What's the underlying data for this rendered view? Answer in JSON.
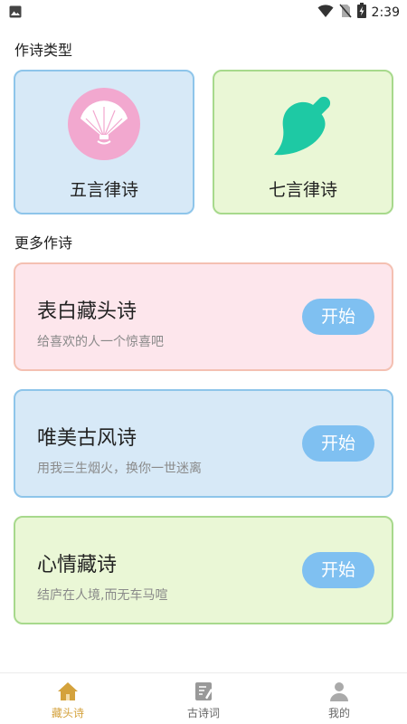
{
  "status_bar": {
    "time": "2:39",
    "icons": [
      "image-icon",
      "wifi-icon",
      "no-sim-icon",
      "battery-charging-icon"
    ]
  },
  "sections": {
    "poem_types_title": "作诗类型",
    "more_title": "更多作诗"
  },
  "poem_types": [
    {
      "label": "五言律诗",
      "icon": "folding-fan-icon"
    },
    {
      "label": "七言律诗",
      "icon": "leaf-icon"
    }
  ],
  "more_cards": [
    {
      "title": "表白藏头诗",
      "subtitle": "给喜欢的人一个惊喜吧",
      "button": "开始"
    },
    {
      "title": "唯美古风诗",
      "subtitle": "用我三生烟火，换你一世迷离",
      "button": "开始"
    },
    {
      "title": "心情藏诗",
      "subtitle": "结庐在人境,而无车马喧",
      "button": "开始"
    }
  ],
  "bottom_nav": [
    {
      "label": "藏头诗",
      "icon": "home-icon",
      "active": true
    },
    {
      "label": "古诗词",
      "icon": "notebook-icon",
      "active": false
    },
    {
      "label": "我的",
      "icon": "person-icon",
      "active": false
    }
  ],
  "colors": {
    "accent_blue": "#7fc0f1",
    "nav_active": "#d4a23c",
    "fan_pink": "#f2a8cf",
    "leaf_teal": "#1ec9a4"
  }
}
